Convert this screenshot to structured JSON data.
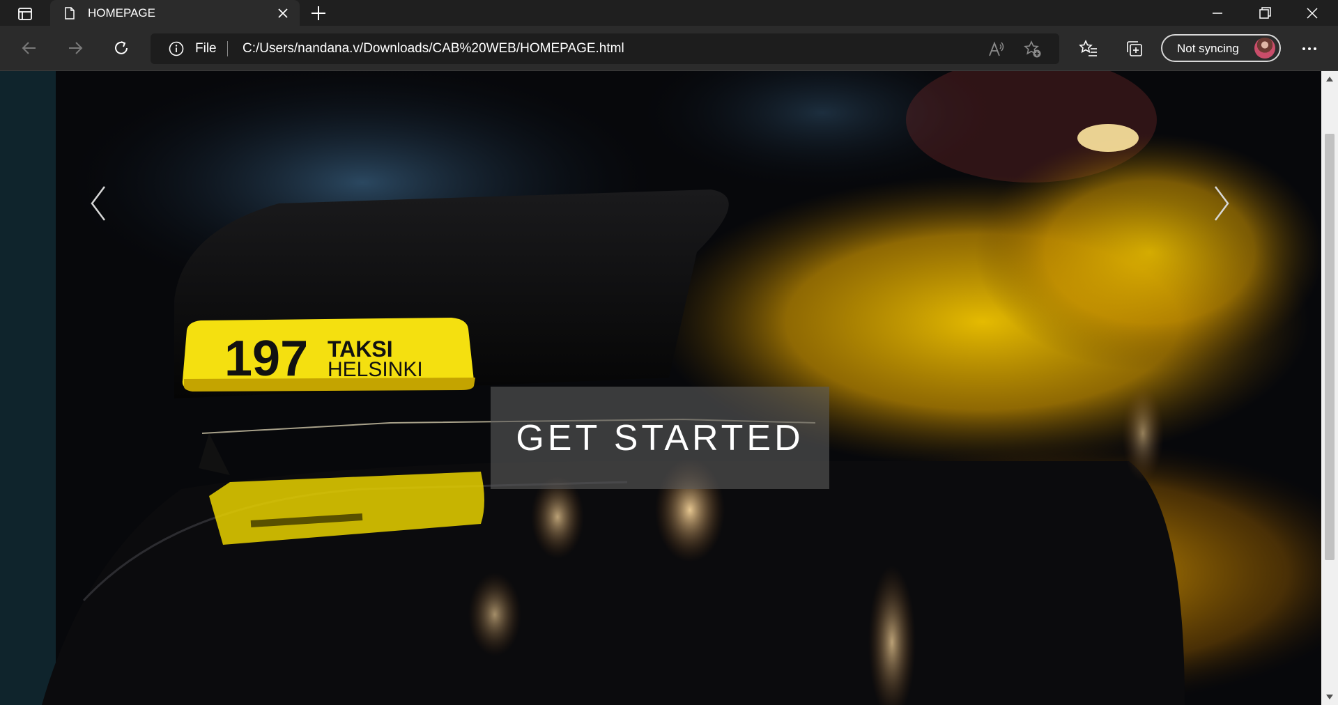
{
  "browser": {
    "tab": {
      "title": "HOMEPAGE",
      "favicon": "page-icon"
    },
    "address": {
      "scheme_label": "File",
      "url": "C:/Users/nandana.v/Downloads/CAB%20WEB/HOMEPAGE.html"
    },
    "profile": {
      "label": "Not syncing"
    }
  },
  "page": {
    "cta_label": "GET STARTED",
    "hero_sign": {
      "number": "197",
      "line1": "TAKSI",
      "line2": "HELSINKI"
    }
  },
  "colors": {
    "taxi_yellow": "#f4d400",
    "overlay": "#5a5a5a"
  }
}
